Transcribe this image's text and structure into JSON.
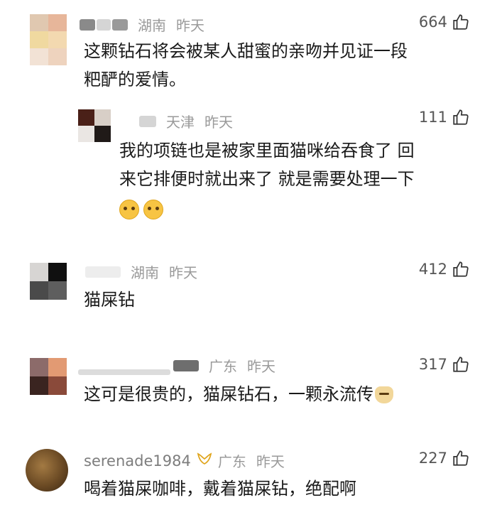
{
  "comments": [
    {
      "region": "湖南",
      "time": "昨天",
      "likes": "664",
      "text_lines": [
        "这颗钻石将会被某人甜蜜的亲吻并见证一段",
        "粑酽的爱情。"
      ],
      "colors": [
        "#e0c8b0",
        "#e7b69a",
        "#f0d9a0",
        "#f3d9b0",
        "#f2e2d5",
        "#eed3be"
      ]
    },
    {
      "region": "天津",
      "time": "昨天",
      "likes": "111",
      "text_lines": [
        "我的项链也是被家里面猫咪给吞食了 回",
        "来它排便时就出来了 就是需要处理一下"
      ],
      "emojis": [
        "crying-laughing-emoji",
        "crying-laughing-emoji"
      ],
      "colors": [
        "#4a2018",
        "#d8cfc7",
        "#201a18",
        "#eae6e3"
      ]
    },
    {
      "region": "湖南",
      "time": "昨天",
      "likes": "412",
      "text_lines": [
        "猫屎钻"
      ],
      "colors": [
        "#d7d5d3",
        "#101010",
        "#4a4a4a",
        "#5e5e5e"
      ]
    },
    {
      "region": "广东",
      "time": "昨天",
      "likes": "317",
      "text_lines": [
        "这可是很贵的，猫屎钻石，一颗永流传"
      ],
      "emojis": [
        "doge-emoji"
      ],
      "colors": [
        "#8c6b6a",
        "#e29a73",
        "#3a2420",
        "#8a4a3a"
      ]
    },
    {
      "username": "serenade1984",
      "badge": "ribbon-badge-icon",
      "region": "广东",
      "time": "昨天",
      "likes": "227",
      "text_lines": [
        "喝着猫屎咖啡，戴着猫屎钻，绝配啊"
      ],
      "avatar_color": "#6b4a24"
    }
  ]
}
